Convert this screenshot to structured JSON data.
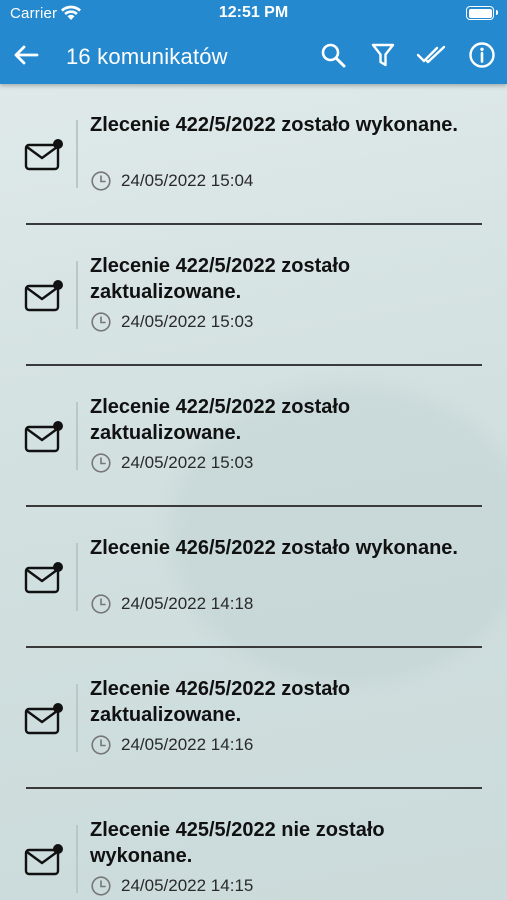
{
  "status_bar": {
    "carrier": "Carrier",
    "time": "12:51 PM"
  },
  "header": {
    "title": "16 komunikatów",
    "color": "#2489cf",
    "icons": [
      "back-arrow-icon",
      "search-icon",
      "filter-icon",
      "mark-all-read-icon",
      "info-icon"
    ]
  },
  "messages": [
    {
      "title": "Zlecenie 422/5/2022 zostało wykonane.",
      "date": "24/05/2022 15:04"
    },
    {
      "title": "Zlecenie 422/5/2022 zostało zaktualizowane.",
      "date": "24/05/2022 15:03"
    },
    {
      "title": "Zlecenie 422/5/2022 zostało zaktualizowane.",
      "date": "24/05/2022 15:03"
    },
    {
      "title": "Zlecenie 426/5/2022 zostało wykonane.",
      "date": "24/05/2022 14:18"
    },
    {
      "title": "Zlecenie 426/5/2022 zostało zaktualizowane.",
      "date": "24/05/2022 14:16"
    },
    {
      "title": "Zlecenie 425/5/2022 nie zostało wykonane.",
      "date": "24/05/2022 14:15"
    }
  ]
}
